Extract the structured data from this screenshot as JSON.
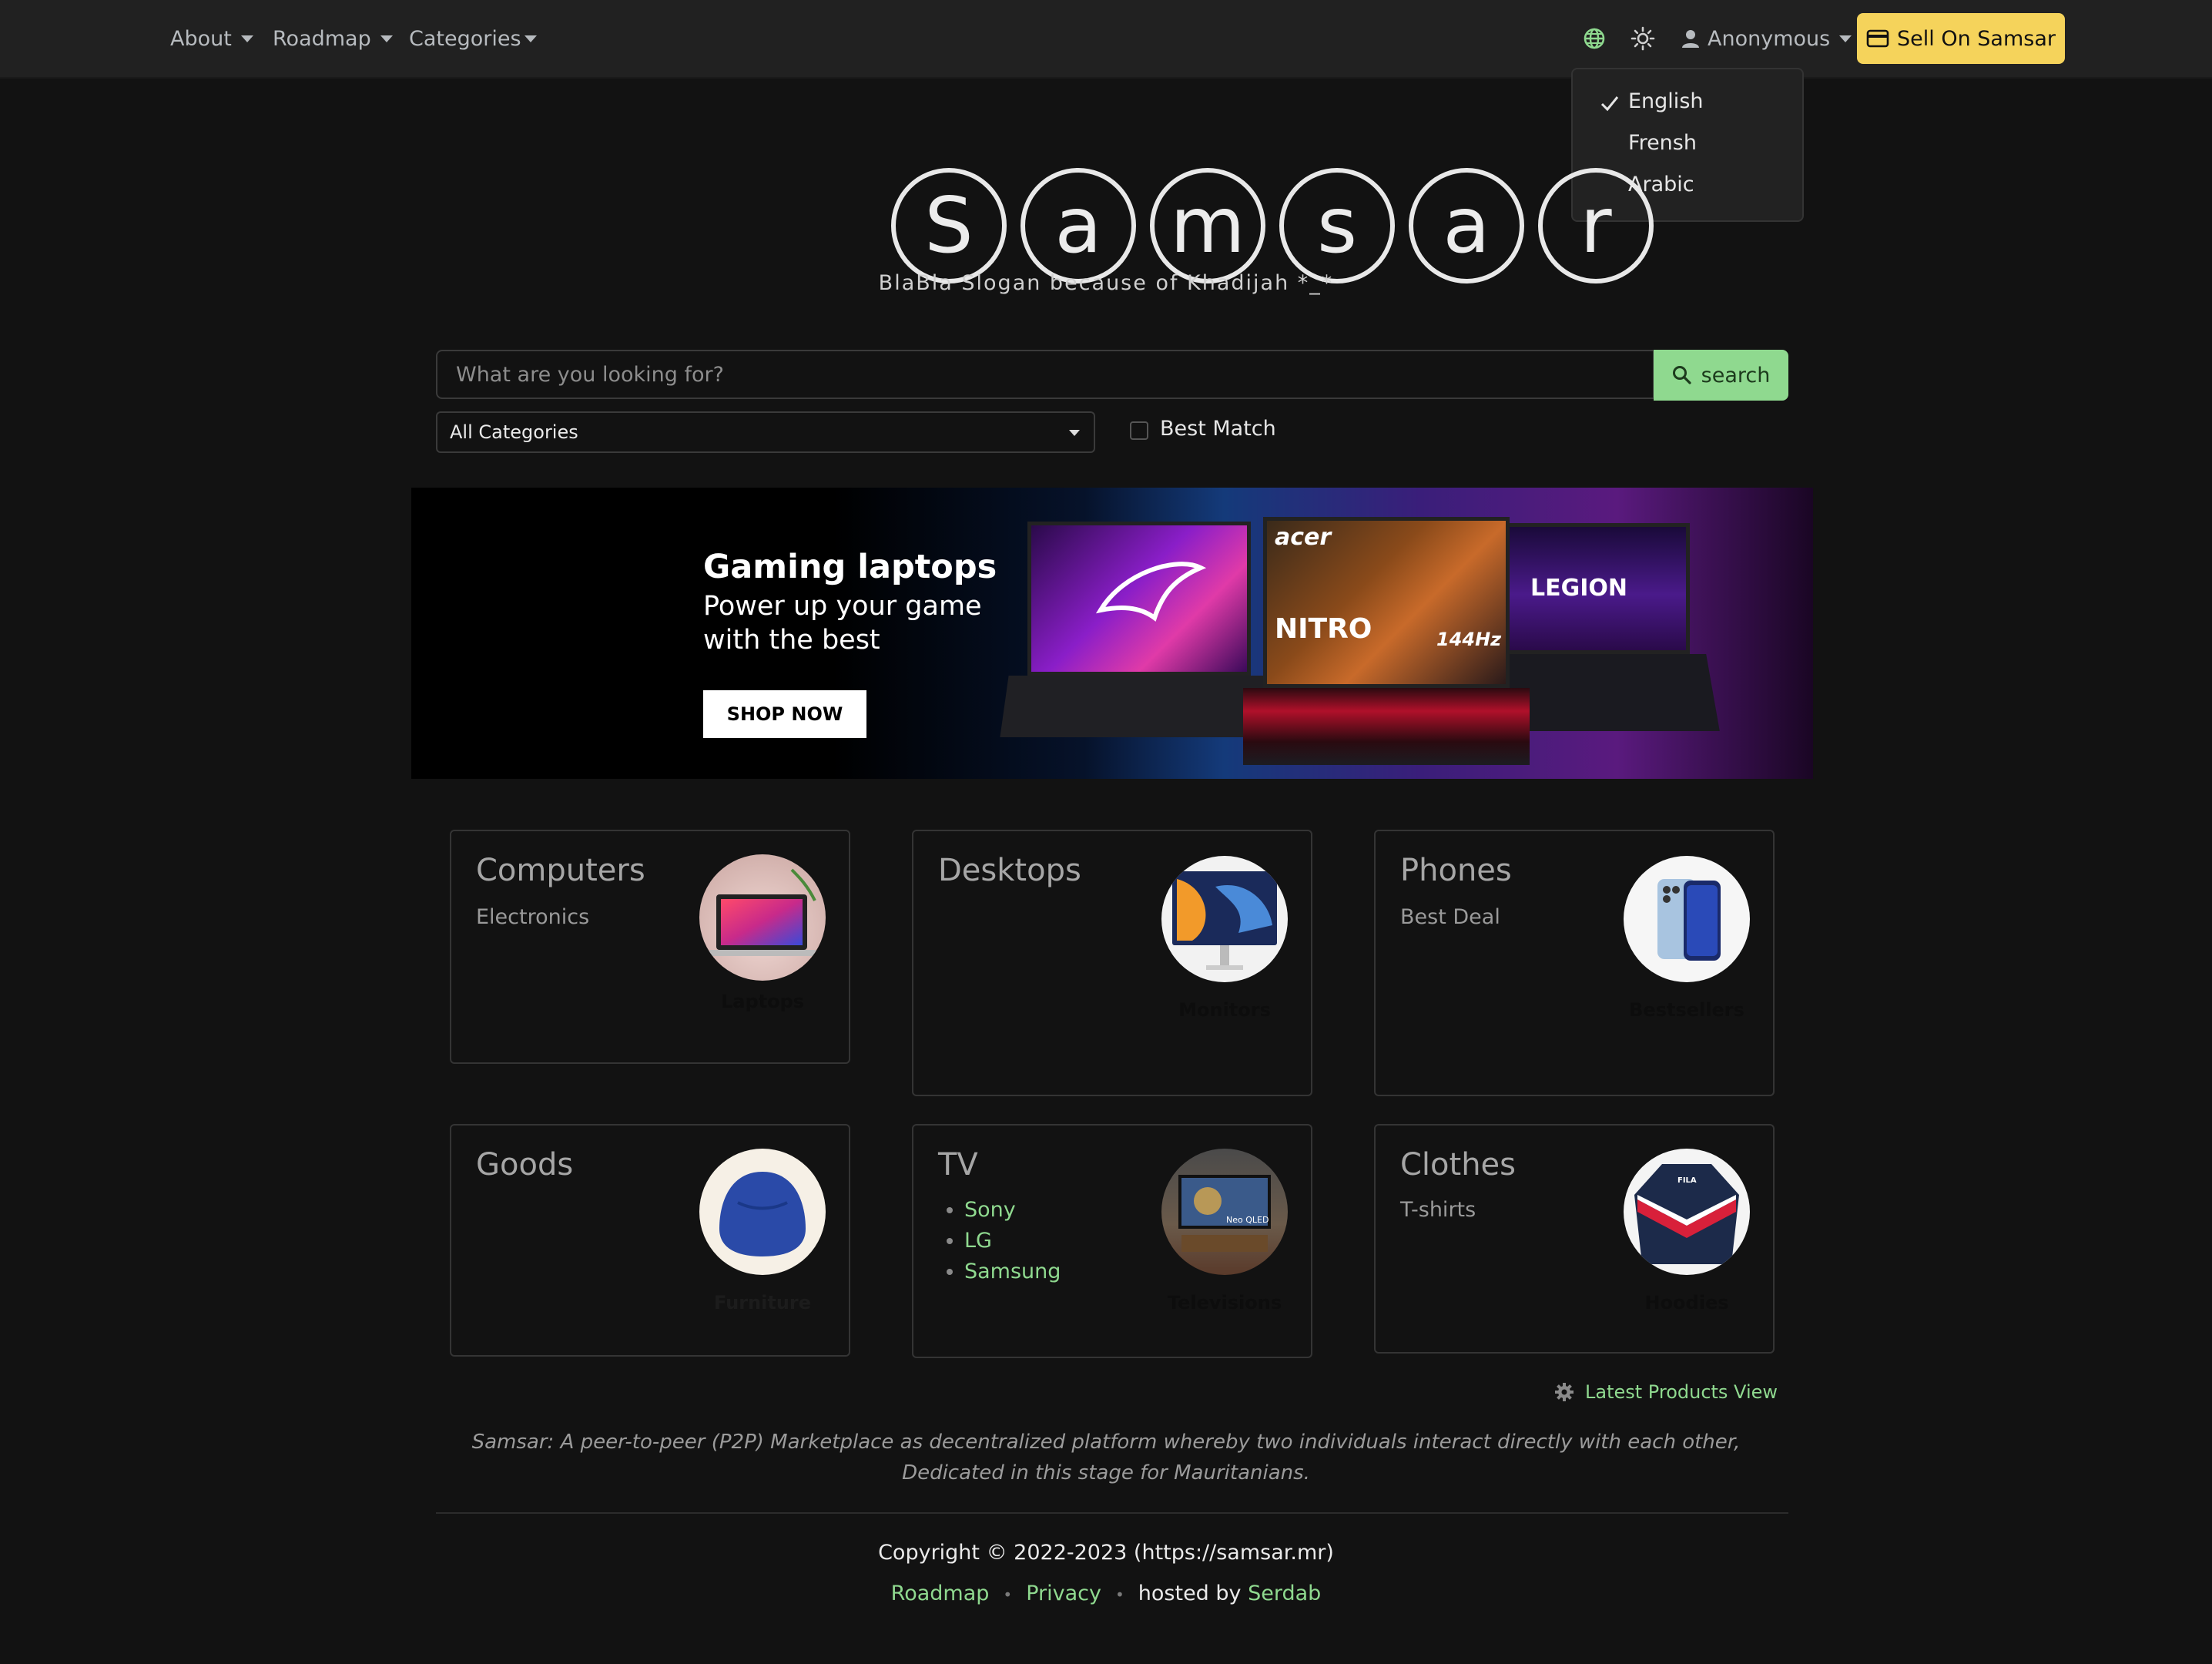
{
  "nav": {
    "about": "About",
    "roadmap": "Roadmap",
    "categories": "Categories",
    "user": "Anonymous",
    "sell": "Sell On Samsar"
  },
  "language_menu": {
    "items": [
      "English",
      "Frensh",
      "Arabic"
    ],
    "selected": "English"
  },
  "hero": {
    "logo_letters": [
      "S",
      "a",
      "m",
      "s",
      "a",
      "r"
    ],
    "slogan": "BlaBla Slogan because of Khadijah *_*"
  },
  "search": {
    "placeholder": "What are you looking for?",
    "button": "search",
    "category": "All Categories",
    "best_match": "Best Match"
  },
  "banner": {
    "title": "Gaming laptops",
    "subtitle": "Power up your game with the best",
    "button": "SHOP NOW",
    "brand_acer": "acer",
    "brand_nitro": "NITRO",
    "refresh": "144Hz",
    "brand_legion": "LEGION"
  },
  "cards": [
    {
      "title": "Computers",
      "subtitle": "Electronics",
      "caption": "Laptops"
    },
    {
      "title": "Desktops",
      "subtitle": "",
      "caption": "Monitors"
    },
    {
      "title": "Phones",
      "subtitle": "Best Deal",
      "caption": "Bestsellers"
    },
    {
      "title": "Goods",
      "subtitle": "",
      "caption": "Furniture"
    },
    {
      "title": "TV",
      "list": [
        "Sony",
        "LG",
        "Samsung"
      ],
      "caption": "Televisions",
      "tv_label": "Neo QLED"
    },
    {
      "title": "Clothes",
      "subtitle": "T-shirts",
      "caption": "Hoodies",
      "hoodie_brand": "FILA"
    }
  ],
  "footer": {
    "latest": "Latest Products View",
    "about": "Samsar: A peer-to-peer (P2P) Marketplace as decentralized platform whereby two individuals interact directly with each other, Dedicated in this stage for Mauritanians.",
    "copyright": "Copyright © 2022-2023 (https://samsar.mr)",
    "roadmap": "Roadmap",
    "privacy": "Privacy",
    "hosted_by": "hosted by",
    "host": "Serdab"
  },
  "colors": {
    "accent_green": "#8fd98f",
    "sell_yellow": "#f5d35b",
    "background": "#121212",
    "navbar": "#212121"
  }
}
